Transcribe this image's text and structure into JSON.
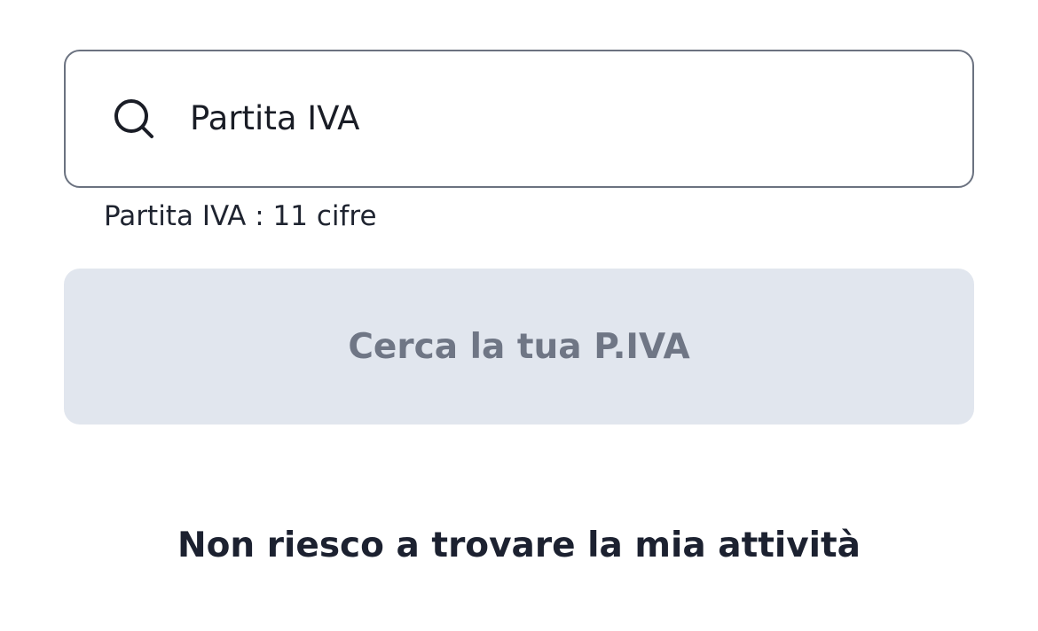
{
  "search": {
    "placeholder": "Partita IVA",
    "value": "",
    "icon": "search-icon"
  },
  "helper": {
    "text": "Partita IVA : 11 cifre"
  },
  "actions": {
    "search_button_label": "Cerca la tua P.IVA",
    "cant_find_label": "Non riesco a trovare la mia attività"
  },
  "colors": {
    "input_border": "#6b7280",
    "button_bg_disabled": "#e1e6ee",
    "button_text_disabled": "#6f7685",
    "text_primary": "#1c2130"
  }
}
